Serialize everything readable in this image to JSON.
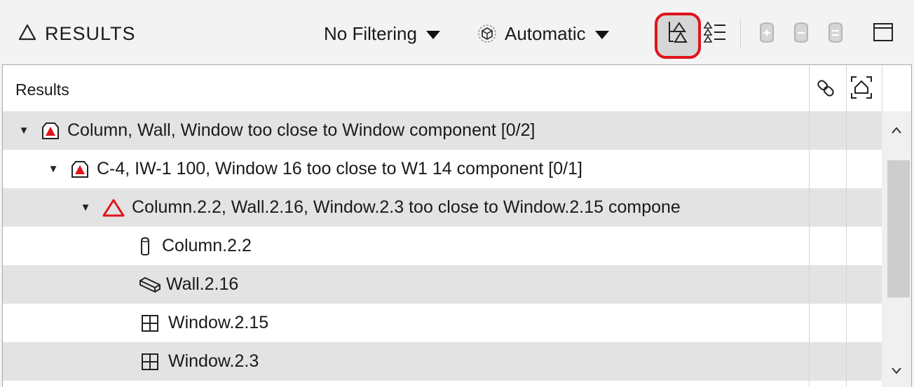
{
  "header": {
    "title": "RESULTS",
    "title_icon": "triangle-outline-icon",
    "filter_dropdown": {
      "value": "No Filtering"
    },
    "mode_dropdown": {
      "value": "Automatic",
      "icon": "cube-gear-icon"
    },
    "toolbar_icons": [
      "group-by-component-icon",
      "sort-list-icon",
      "add-item-icon",
      "remove-item-icon",
      "clear-item-icon",
      "window-layout-icon"
    ]
  },
  "table": {
    "column_header": "Results",
    "column_icons": [
      "link-icon",
      "focus-view-icon"
    ],
    "rows": [
      {
        "level": 0,
        "expanded": true,
        "icon": "red-triangle-box-icon",
        "text": "Column, Wall, Window too close to Window component [0/2]"
      },
      {
        "level": 1,
        "expanded": true,
        "icon": "red-triangle-box-icon",
        "text": "C-4, IW-1 100, Window 16 too close to W1 14 component [0/1]"
      },
      {
        "level": 2,
        "expanded": true,
        "icon": "red-triangle-outline-icon",
        "text": "Column.2.2, Wall.2.16, Window.2.3 too close to Window.2.15 compone"
      },
      {
        "level": 3,
        "icon": "column-icon",
        "text": "Column.2.2"
      },
      {
        "level": 3,
        "icon": "wall-icon",
        "text": "Wall.2.16"
      },
      {
        "level": 3,
        "icon": "window-icon",
        "text": "Window.2.15"
      },
      {
        "level": 3,
        "icon": "window-icon",
        "text": "Window.2.3"
      }
    ]
  },
  "colors": {
    "accent_red": "#e0141c",
    "row_alt": "#e3e3e3"
  }
}
